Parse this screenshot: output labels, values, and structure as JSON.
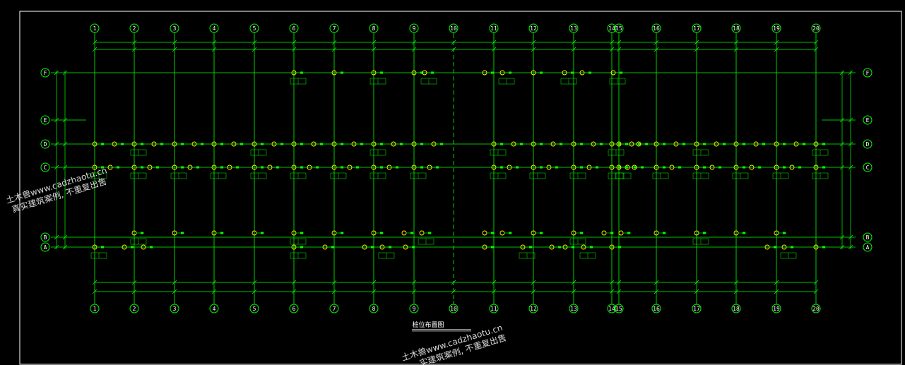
{
  "drawing": {
    "title": "桩位布置图",
    "watermark": {
      "line1": "土木兽www.cadzhaotu.cn",
      "line2": "真实建筑案例, 不重复出售",
      "line3": "土木兽www.cadzhaotu.cn",
      "line4": "实建筑案例, 不重复出售"
    },
    "grid_columns": [
      "1",
      "2",
      "3",
      "4",
      "5",
      "6",
      "7",
      "8",
      "9",
      "10",
      "11",
      "12",
      "13",
      "14",
      "15",
      "16",
      "17",
      "18",
      "19",
      "20"
    ],
    "grid_rows": [
      "F",
      "E",
      "D",
      "C",
      "B",
      "A"
    ],
    "colors": {
      "background": "#000000",
      "grid_line": "#00ff00",
      "axis_bubble": "#00ff00",
      "text": "#ffffff",
      "pile": "#ffff00",
      "dimension": "#00ff00",
      "label": "#00ffff"
    }
  }
}
